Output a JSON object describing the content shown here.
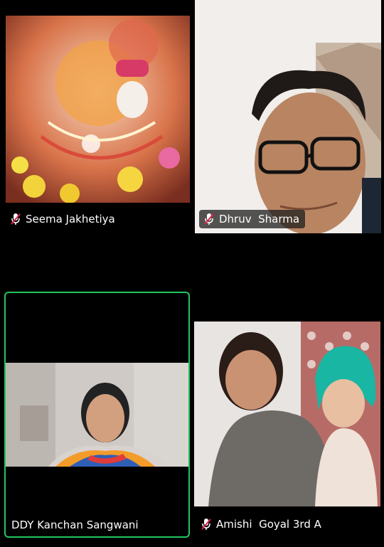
{
  "participants": [
    {
      "name": "Seema Jakhetiya",
      "muted": true
    },
    {
      "name": "Dhruv  Sharma",
      "muted": true
    },
    {
      "name": "DDY Kanchan Sangwani",
      "muted": false,
      "active_speaker": true
    },
    {
      "name": "Amishi  Goyal 3rd A",
      "muted": true
    }
  ],
  "colors": {
    "active_border": "#22c55e",
    "background": "#000000"
  },
  "icons": {
    "muted": "microphone-muted-icon"
  }
}
